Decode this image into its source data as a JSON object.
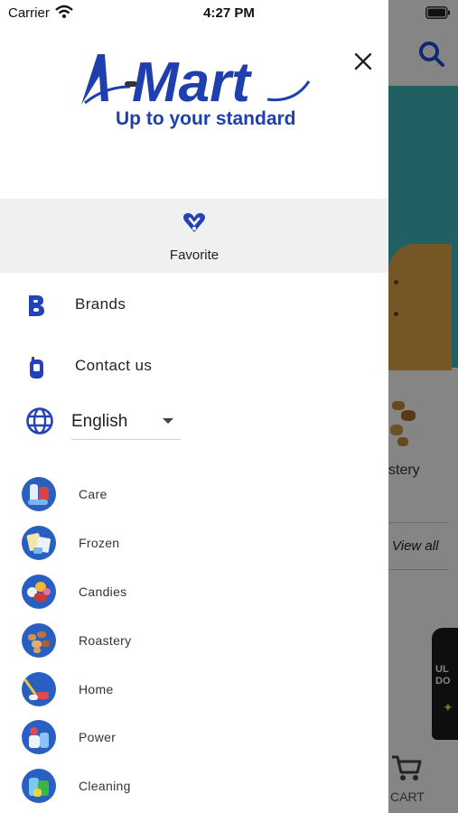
{
  "status_bar": {
    "carrier": "Carrier",
    "time": "4:27 PM"
  },
  "brand": {
    "logo_name": "Mart",
    "logo_prefix": "A",
    "slogan": "Up to your standard",
    "color": "#1f3fae"
  },
  "favorite": {
    "label": "Favorite"
  },
  "menu": [
    {
      "label": "Brands",
      "icon": "brands-b-icon"
    },
    {
      "label": "Contact us",
      "icon": "phone-icon"
    }
  ],
  "language": {
    "selected": "English",
    "icon": "globe-icon"
  },
  "categories": [
    {
      "label": "Care",
      "icon": "care-icon"
    },
    {
      "label": "Frozen",
      "icon": "frozen-icon"
    },
    {
      "label": "Candies",
      "icon": "candies-icon"
    },
    {
      "label": "Roastery",
      "icon": "roastery-icon"
    },
    {
      "label": "Home",
      "icon": "home-icon"
    },
    {
      "label": "Power",
      "icon": "power-icon"
    },
    {
      "label": "Cleaning",
      "icon": "cleaning-icon"
    }
  ],
  "background_screen": {
    "category_label": "stery",
    "view_all": "View all",
    "product_text": "UL DO",
    "cart_label": "CART"
  },
  "colors": {
    "accent": "#2342b8",
    "drawer_bg": "#ffffff",
    "favorite_bg": "#f0f0f0",
    "overlay": "#000000"
  }
}
